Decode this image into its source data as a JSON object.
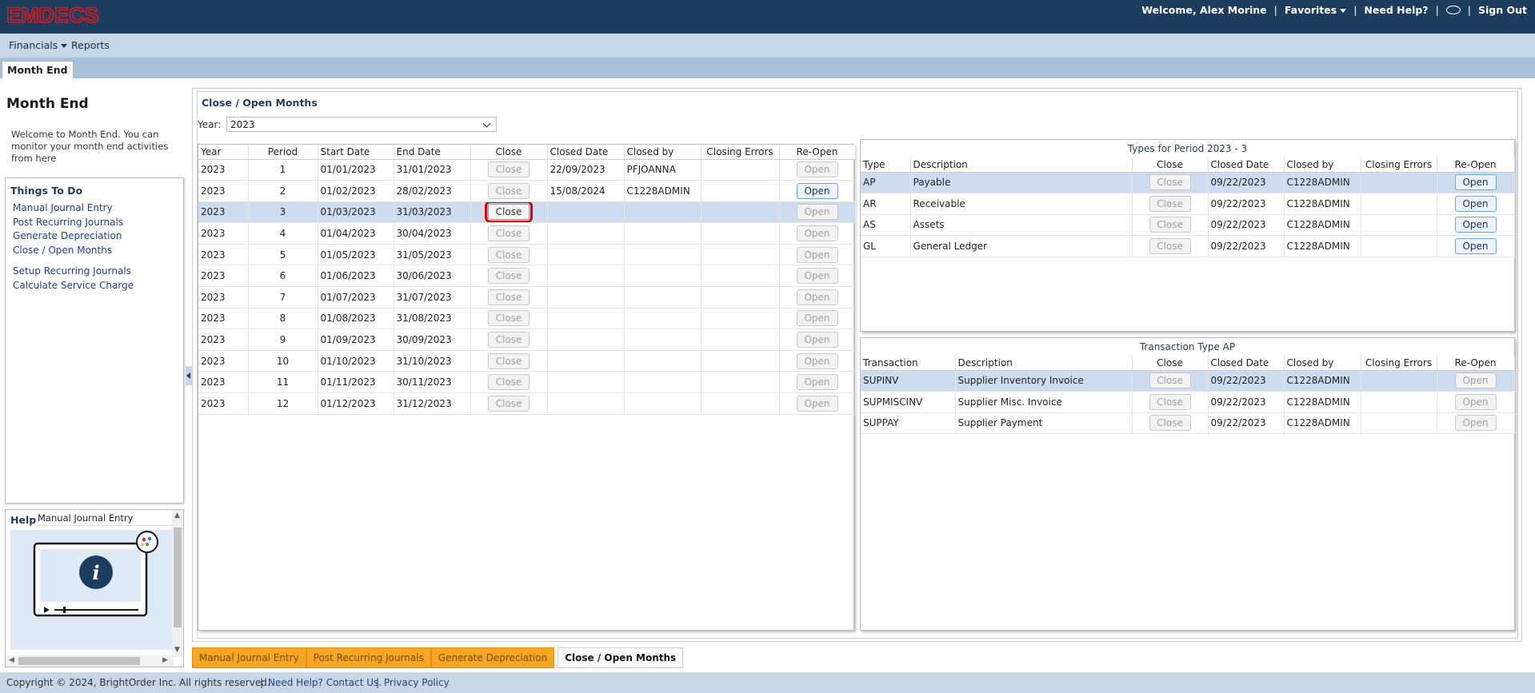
{
  "app": {
    "logo": "EMDECS"
  },
  "topnav": {
    "welcome": "Welcome, Alex Morine",
    "favorites": "Favorites",
    "help": "Need Help?",
    "signout": "Sign Out"
  },
  "menu": {
    "financials": "Financials",
    "reports": "Reports"
  },
  "page_tab": "Month End",
  "left": {
    "title": "Month End",
    "description": "Welcome to Month End. You can monitor your month end activities from here",
    "todo_title": "Things To Do",
    "todo_items": [
      "Manual Journal Entry",
      "Post Recurring Journals",
      "Generate Depreciation",
      "Close / Open Months",
      "Setup Recurring Journals",
      "Calculate Service Charge"
    ],
    "help_label": "Help",
    "help_topic": "Manual Journal Entry"
  },
  "main": {
    "title": "Close / Open Months",
    "year_label": "Year:",
    "year_value": "2023",
    "periods": {
      "headers": [
        "Year",
        "Period",
        "Start Date",
        "End Date",
        "Close",
        "Closed Date",
        "Closed by",
        "Closing Errors",
        "Re-Open"
      ],
      "rows": [
        {
          "year": "2023",
          "period": "1",
          "start": "01/01/2023",
          "end": "31/01/2023",
          "close": "Close",
          "closed_date": "22/09/2023",
          "closed_by": "PFJOANNA",
          "errors": "",
          "reopen": "Open"
        },
        {
          "year": "2023",
          "period": "2",
          "start": "01/02/2023",
          "end": "28/02/2023",
          "close": "Close",
          "closed_date": "15/08/2024",
          "closed_by": "C1228ADMIN",
          "errors": "",
          "reopen": "Open"
        },
        {
          "year": "2023",
          "period": "3",
          "start": "01/03/2023",
          "end": "31/03/2023",
          "close": "Close",
          "closed_date": "",
          "closed_by": "",
          "errors": "",
          "reopen": "Open"
        },
        {
          "year": "2023",
          "period": "4",
          "start": "01/04/2023",
          "end": "30/04/2023",
          "close": "Close",
          "closed_date": "",
          "closed_by": "",
          "errors": "",
          "reopen": "Open"
        },
        {
          "year": "2023",
          "period": "5",
          "start": "01/05/2023",
          "end": "31/05/2023",
          "close": "Close",
          "closed_date": "",
          "closed_by": "",
          "errors": "",
          "reopen": "Open"
        },
        {
          "year": "2023",
          "period": "6",
          "start": "01/06/2023",
          "end": "30/06/2023",
          "close": "Close",
          "closed_date": "",
          "closed_by": "",
          "errors": "",
          "reopen": "Open"
        },
        {
          "year": "2023",
          "period": "7",
          "start": "01/07/2023",
          "end": "31/07/2023",
          "close": "Close",
          "closed_date": "",
          "closed_by": "",
          "errors": "",
          "reopen": "Open"
        },
        {
          "year": "2023",
          "period": "8",
          "start": "01/08/2023",
          "end": "31/08/2023",
          "close": "Close",
          "closed_date": "",
          "closed_by": "",
          "errors": "",
          "reopen": "Open"
        },
        {
          "year": "2023",
          "period": "9",
          "start": "01/09/2023",
          "end": "30/09/2023",
          "close": "Close",
          "closed_date": "",
          "closed_by": "",
          "errors": "",
          "reopen": "Open"
        },
        {
          "year": "2023",
          "period": "10",
          "start": "01/10/2023",
          "end": "31/10/2023",
          "close": "Close",
          "closed_date": "",
          "closed_by": "",
          "errors": "",
          "reopen": "Open"
        },
        {
          "year": "2023",
          "period": "11",
          "start": "01/11/2023",
          "end": "30/11/2023",
          "close": "Close",
          "closed_date": "",
          "closed_by": "",
          "errors": "",
          "reopen": "Open"
        },
        {
          "year": "2023",
          "period": "12",
          "start": "01/12/2023",
          "end": "31/12/2023",
          "close": "Close",
          "closed_date": "",
          "closed_by": "",
          "errors": "",
          "reopen": "Open"
        }
      ]
    },
    "types": {
      "caption": "Types for Period 2023 - 3",
      "headers": [
        "Type",
        "Description",
        "Close",
        "Closed Date",
        "Closed by",
        "Closing Errors",
        "Re-Open"
      ],
      "rows": [
        {
          "type": "AP",
          "desc": "Payable",
          "close": "Close",
          "closed_date": "09/22/2023",
          "closed_by": "C1228ADMIN",
          "errors": "",
          "reopen": "Open"
        },
        {
          "type": "AR",
          "desc": "Receivable",
          "close": "Close",
          "closed_date": "09/22/2023",
          "closed_by": "C1228ADMIN",
          "errors": "",
          "reopen": "Open"
        },
        {
          "type": "AS",
          "desc": "Assets",
          "close": "Close",
          "closed_date": "09/22/2023",
          "closed_by": "C1228ADMIN",
          "errors": "",
          "reopen": "Open"
        },
        {
          "type": "GL",
          "desc": "General Ledger",
          "close": "Close",
          "closed_date": "09/22/2023",
          "closed_by": "C1228ADMIN",
          "errors": "",
          "reopen": "Open"
        }
      ]
    },
    "transactions": {
      "caption": "Transaction Type AP",
      "headers": [
        "Transaction",
        "Description",
        "Close",
        "Closed Date",
        "Closed by",
        "Closing Errors",
        "Re-Open"
      ],
      "rows": [
        {
          "trans": "SUPINV",
          "desc": "Supplier Inventory Invoice",
          "close": "Close",
          "closed_date": "09/22/2023",
          "closed_by": "C1228ADMIN",
          "errors": "",
          "reopen": "Open"
        },
        {
          "trans": "SUPMISCINV",
          "desc": "Supplier Misc. Invoice",
          "close": "Close",
          "closed_date": "09/22/2023",
          "closed_by": "C1228ADMIN",
          "errors": "",
          "reopen": "Open"
        },
        {
          "trans": "SUPPAY",
          "desc": "Supplier Payment",
          "close": "Close",
          "closed_date": "09/22/2023",
          "closed_by": "C1228ADMIN",
          "errors": "",
          "reopen": "Open"
        }
      ]
    }
  },
  "bottom_tabs": [
    "Manual Journal Entry",
    "Post Recurring Journals",
    "Generate Depreciation",
    "Close / Open Months"
  ],
  "footer": {
    "copyright": "Copyright © 2024, BrightOrder Inc. All rights reserved.",
    "contact": "Need Help? Contact Us.",
    "privacy": "Privacy Policy"
  },
  "icons": [
    "favorites-caret-icon",
    "chat-bubble-icon",
    "financials-caret-icon",
    "year-chevron-down-icon",
    "info-video-icon",
    "collapse-arrow-icon"
  ],
  "colors": {
    "header": "#1c3d5e",
    "logo": "#e3161b",
    "selected_row": "#cddcef",
    "tab_orange": "#f5a623",
    "highlight": "#e00000"
  }
}
